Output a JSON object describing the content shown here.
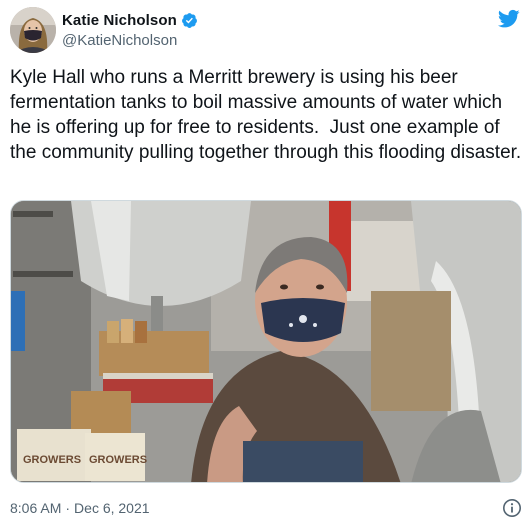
{
  "tweet": {
    "author": {
      "display_name": "Katie Nicholson",
      "handle": "@KatieNicholson",
      "verified": true,
      "avatar_icon": "user-avatar-photo"
    },
    "text": "Kyle Hall who runs a Merritt brewery is using his beer fermentation tanks to boil massive amounts of water which he is offering up for free to residents.  Just one example of the community pulling together through this flooding disaster.",
    "media": {
      "type": "photo",
      "icon": "photo-brewery-man",
      "box_labels": [
        "GROWERS",
        "GROWERS"
      ]
    },
    "time": "8:06 AM",
    "separator": "·",
    "date": "Dec 6, 2021"
  },
  "icons": {
    "brand": "twitter-bird-icon",
    "verified": "verified-badge-icon",
    "info": "info-icon"
  },
  "colors": {
    "brand_blue": "#1d9bf0",
    "text_primary": "#0f1419",
    "text_secondary": "#536471",
    "border": "#cfd9de"
  }
}
